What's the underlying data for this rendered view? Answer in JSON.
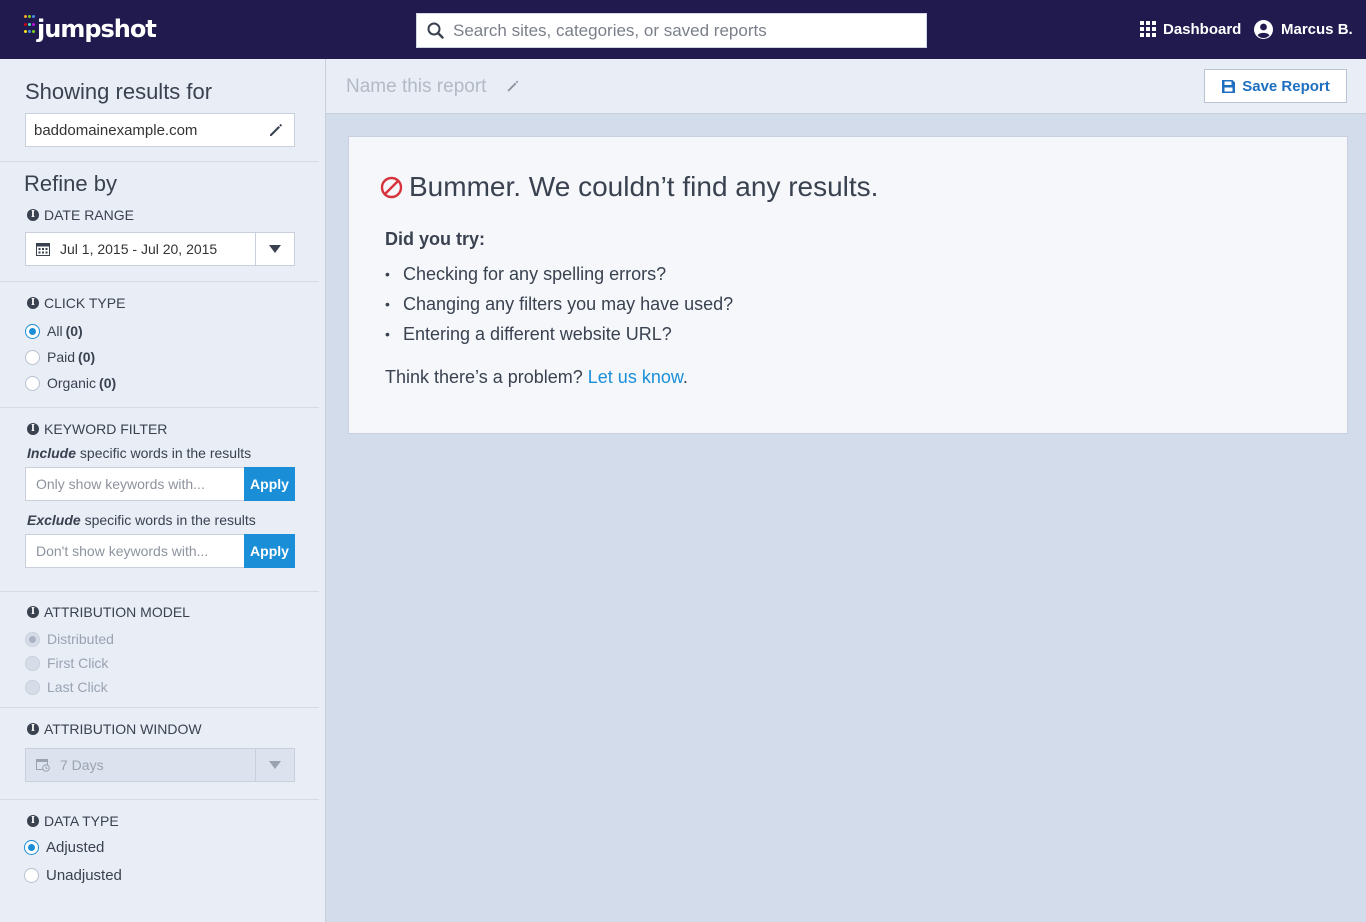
{
  "header": {
    "logo_text": "jumpshot",
    "search_placeholder": "Search sites, categories, or saved reports",
    "dashboard_label": "Dashboard",
    "user_name": "Marcus B."
  },
  "sidebar": {
    "showing_title": "Showing results for",
    "domain_value": "baddomainexample.com",
    "refine_title": "Refine by",
    "date_range": {
      "label": "DATE RANGE",
      "value": "Jul 1, 2015 - Jul 20, 2015"
    },
    "click_type": {
      "label": "CLICK TYPE",
      "options": [
        {
          "label": "All",
          "count": "(0)",
          "selected": true
        },
        {
          "label": "Paid",
          "count": "(0)",
          "selected": false
        },
        {
          "label": "Organic",
          "count": "(0)",
          "selected": false
        }
      ]
    },
    "keyword_filter": {
      "label": "KEYWORD FILTER",
      "include_em": "Include",
      "include_rest": " specific words in the results",
      "include_placeholder": "Only show keywords with...",
      "exclude_em": "Exclude",
      "exclude_rest": " specific words in the results",
      "exclude_placeholder": "Don't show keywords with...",
      "apply_label": "Apply"
    },
    "attribution_model": {
      "label": "ATTRIBUTION MODEL",
      "options": [
        {
          "label": "Distributed",
          "selected": true
        },
        {
          "label": "First Click",
          "selected": false
        },
        {
          "label": "Last Click",
          "selected": false
        }
      ]
    },
    "attribution_window": {
      "label": "ATTRIBUTION WINDOW",
      "value": "7 Days"
    },
    "data_type": {
      "label": "DATA TYPE",
      "options": [
        {
          "label": "Adjusted",
          "selected": true
        },
        {
          "label": "Unadjusted",
          "selected": false
        }
      ]
    }
  },
  "main": {
    "report_name_placeholder": "Name this report",
    "save_label": "Save Report",
    "empty": {
      "title": "Bummer. We couldn’t find any results.",
      "did_you_try": "Did you try:",
      "tips": [
        "Checking for any spelling errors?",
        "Changing any filters you may have used?",
        "Entering a different website URL?"
      ],
      "problem_text": "Think there’s a problem? ",
      "problem_link": "Let us know",
      "problem_end": "."
    }
  },
  "colors": {
    "header_bg": "#201a4e",
    "accent": "#1a8fd8",
    "error_red": "#d8323a"
  }
}
